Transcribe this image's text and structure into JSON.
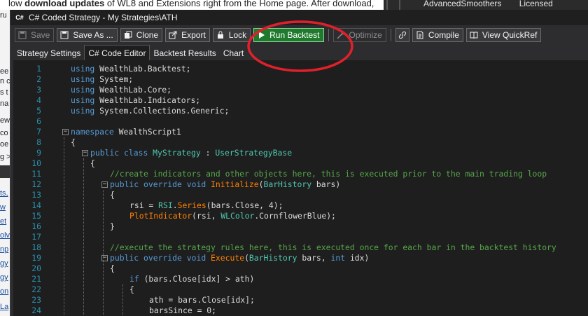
{
  "background": {
    "top_text_prefix": "low ",
    "top_text_bold": "download updates",
    "top_text_suffix": " of WL8 and Extensions right from the Home page. After download,",
    "right_items": [
      "AdvancedSmoothers",
      "Licensed"
    ],
    "left_fragments": [
      "ru",
      "ee",
      "n c",
      "s t",
      "na",
      "ew",
      "co",
      "oe",
      "g >",
      "ts,",
      "w",
      "et",
      "olv",
      "np",
      "gy",
      "gy",
      "on",
      "La"
    ]
  },
  "window": {
    "title": "C# Coded Strategy - My Strategies\\ATH",
    "icon_text": "C#"
  },
  "toolbar": {
    "save": "Save",
    "save_as": "Save As ...",
    "clone": "Clone",
    "export": "Export",
    "lock": "Lock",
    "run_backtest": "Run Backtest",
    "optimize": "Optimize",
    "compile": "Compile",
    "view_quickref": "View QuickRef"
  },
  "tabs": [
    "Strategy Settings",
    "C# Code Editor",
    "Backtest Results",
    "Chart"
  ],
  "active_tab": "C# Code Editor",
  "colors": {
    "keyword": "#569cd6",
    "class": "#4ec9b0",
    "comment": "#57a64a",
    "method": "#ff8000",
    "line_number": "#2b91af",
    "run_button": "#1f7a2d",
    "annotation": "#e0202a"
  },
  "code_lines": [
    {
      "n": "1",
      "indent": 0,
      "fold": "",
      "html": "<span class='kw'>using</span> WealthLab.Backtest;"
    },
    {
      "n": "2",
      "indent": 0,
      "fold": "",
      "html": "<span class='kw'>using</span> System;"
    },
    {
      "n": "3",
      "indent": 0,
      "fold": "",
      "html": "<span class='kw'>using</span> WealthLab.Core;"
    },
    {
      "n": "4",
      "indent": 0,
      "fold": "",
      "html": "<span class='kw'>using</span> WealthLab.Indicators;"
    },
    {
      "n": "5",
      "indent": 0,
      "fold": "",
      "html": "<span class='kw'>using</span> System.Collections.Generic;"
    },
    {
      "n": "6",
      "indent": 0,
      "fold": "",
      "html": ""
    },
    {
      "n": "7",
      "indent": 0,
      "fold": "−",
      "html": "<span class='kw'>namespace</span> WealthScript1"
    },
    {
      "n": "8",
      "indent": 0,
      "fold": "",
      "html": "{"
    },
    {
      "n": "9",
      "indent": 1,
      "fold": "−",
      "html": "<span class='kw'>public</span> <span class='kw'>class</span> <span class='cls'>MyStrategy</span> : <span class='cls'>UserStrategyBase</span>"
    },
    {
      "n": "10",
      "indent": 1,
      "fold": "",
      "html": "{"
    },
    {
      "n": "11",
      "indent": 2,
      "fold": "",
      "html": "<span class='cm'>//create indicators and other objects here, this is executed prior to the main trading loop</span>"
    },
    {
      "n": "12",
      "indent": 2,
      "fold": "−",
      "html": "<span class='kw'>public</span> <span class='kw'>override</span> <span class='kw'>void</span> <span class='mt'>Initialize</span>(<span class='cls'>BarHistory</span> bars)"
    },
    {
      "n": "13",
      "indent": 2,
      "fold": "",
      "html": "{"
    },
    {
      "n": "14",
      "indent": 3,
      "fold": "",
      "html": "rsi = <span class='cls'>RSI</span>.<span class='mt'>Series</span>(bars.Close, 4);"
    },
    {
      "n": "15",
      "indent": 3,
      "fold": "",
      "html": "<span class='mt'>PlotIndicator</span>(rsi, <span class='cls'>WLColor</span>.CornflowerBlue);"
    },
    {
      "n": "16",
      "indent": 2,
      "fold": "",
      "html": "}"
    },
    {
      "n": "17",
      "indent": 2,
      "fold": "",
      "html": ""
    },
    {
      "n": "18",
      "indent": 2,
      "fold": "",
      "html": "<span class='cm'>//execute the strategy rules here, this is executed once for each bar in the backtest history</span>"
    },
    {
      "n": "19",
      "indent": 2,
      "fold": "−",
      "html": "<span class='kw'>public</span> <span class='kw'>override</span> <span class='kw'>void</span> <span class='mt'>Execute</span>(<span class='cls'>BarHistory</span> bars, <span class='kw'>int</span> idx)"
    },
    {
      "n": "20",
      "indent": 2,
      "fold": "",
      "html": "{"
    },
    {
      "n": "21",
      "indent": 3,
      "fold": "",
      "html": "<span class='kw'>if</span> (bars.Close[idx] &gt; ath)"
    },
    {
      "n": "22",
      "indent": 3,
      "fold": "",
      "html": "{"
    },
    {
      "n": "23",
      "indent": 4,
      "fold": "",
      "html": "ath = bars.Close[idx];"
    },
    {
      "n": "24",
      "indent": 4,
      "fold": "",
      "html": "barsSince = 0;"
    }
  ]
}
